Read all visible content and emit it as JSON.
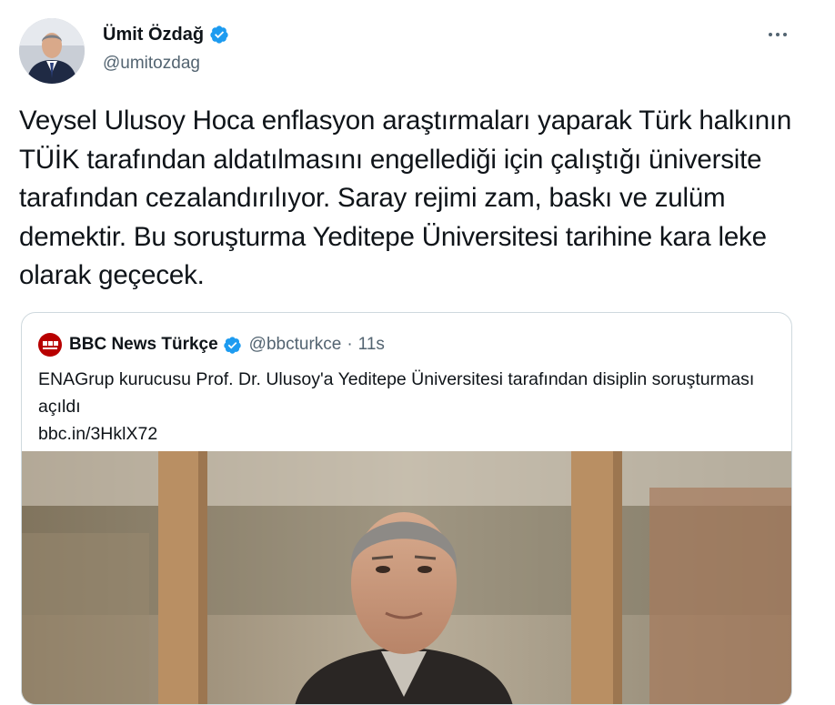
{
  "author": {
    "name": "Ümit Özdağ",
    "handle": "@umitozdag",
    "verified": true
  },
  "tweet": {
    "text": "Veysel Ulusoy Hoca enflasyon araştırmaları  yaparak Türk halkının TÜİK tarafından aldatılmasını engellediği için çalıştığı üniversite tarafından cezalandırılıyor. Saray rejimi zam, baskı ve zulüm demektir. Bu soruşturma Yeditepe Üniversitesi tarihine kara leke olarak geçecek."
  },
  "more_icon": "more-horizontal-icon",
  "quote": {
    "author_name": "BBC News Türkçe",
    "author_handle": "@bbcturkce",
    "separator": "·",
    "time": "11s",
    "verified": true,
    "text": "ENAGrup kurucusu Prof. Dr. Ulusoy'a Yeditepe Üniversitesi tarafından disiplin soruşturması açıldı",
    "link": "bbc.in/3HklX72"
  },
  "colors": {
    "verified": "#1d9bf0",
    "secondary_text": "#536471",
    "border": "#cfd9de",
    "bbc_red": "#b80000"
  }
}
